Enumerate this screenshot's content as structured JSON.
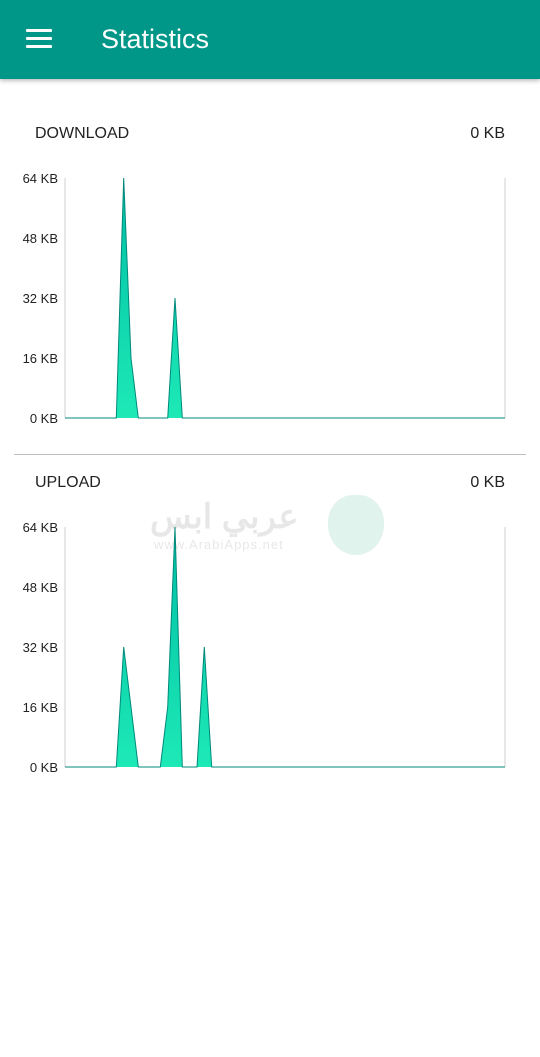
{
  "appbar": {
    "title": "Statistics",
    "menu_icon": "hamburger-menu-icon",
    "color": "#009688"
  },
  "download": {
    "label": "DOWNLOAD",
    "value": "0 KB"
  },
  "upload": {
    "label": "UPLOAD",
    "value": "0 KB"
  },
  "watermark": {
    "text": "عربي ابس",
    "sub": "www.ArabiApps.net"
  },
  "chart_data": [
    {
      "type": "area",
      "name": "download",
      "ylim": [
        0,
        64
      ],
      "yticks": [
        "0 KB",
        "16 KB",
        "32 KB",
        "48 KB",
        "64 KB"
      ],
      "xlim": [
        0,
        15
      ],
      "line_color": "#00897B",
      "fill_top": "#00BFA5",
      "fill_bottom": "#1DE9B6",
      "points": [
        [
          0,
          0
        ],
        [
          1.75,
          0
        ],
        [
          2.0,
          64
        ],
        [
          2.25,
          16
        ],
        [
          2.5,
          0
        ],
        [
          3.5,
          0
        ],
        [
          3.75,
          32
        ],
        [
          4.0,
          0
        ],
        [
          15,
          0
        ]
      ]
    },
    {
      "type": "area",
      "name": "upload",
      "ylim": [
        0,
        64
      ],
      "yticks": [
        "0 KB",
        "16 KB",
        "32 KB",
        "48 KB",
        "64 KB"
      ],
      "xlim": [
        0,
        15
      ],
      "line_color": "#00897B",
      "fill_top": "#00BFA5",
      "fill_bottom": "#1DE9B6",
      "points": [
        [
          0,
          0
        ],
        [
          1.75,
          0
        ],
        [
          2.0,
          32
        ],
        [
          2.5,
          0
        ],
        [
          3.25,
          0
        ],
        [
          3.5,
          16
        ],
        [
          3.75,
          64
        ],
        [
          4.0,
          0
        ],
        [
          4.5,
          0
        ],
        [
          4.75,
          32
        ],
        [
          5.0,
          0
        ],
        [
          15,
          0
        ]
      ]
    }
  ]
}
